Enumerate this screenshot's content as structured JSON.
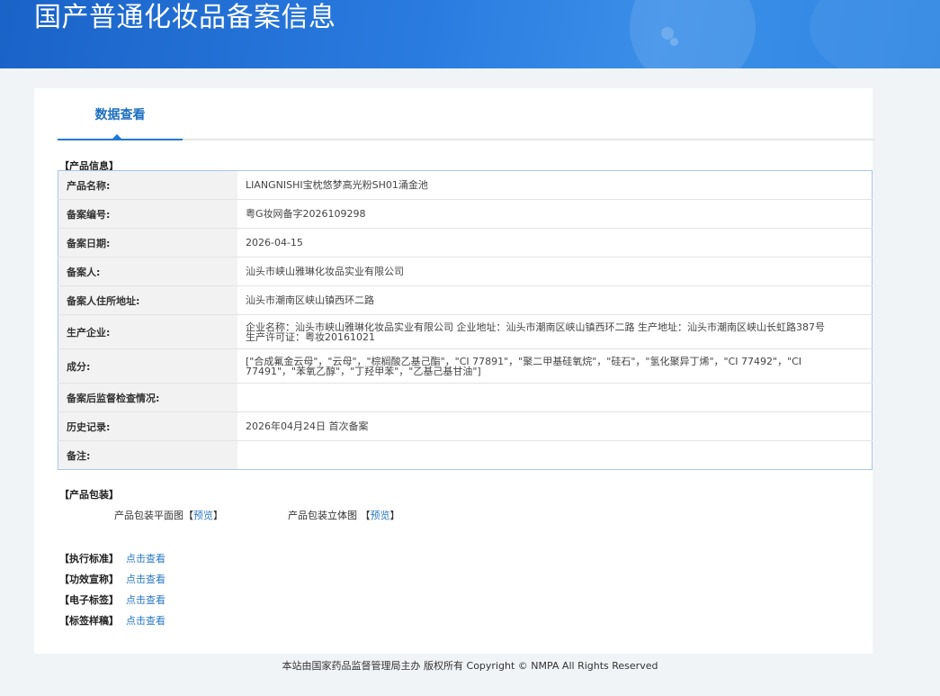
{
  "header": {
    "title": "国产普通化妆品备案信息"
  },
  "tabs": [
    {
      "label": "数据查看"
    }
  ],
  "product_info": {
    "section_title": "【产品信息】",
    "rows": [
      {
        "label": "产品名称:",
        "value": "LIANGNISHI宝枕悠梦高光粉SH01涌金池"
      },
      {
        "label": "备案编号:",
        "value": "粤G妆网备字2026109298"
      },
      {
        "label": "备案日期:",
        "value": "2026-04-15"
      },
      {
        "label": "备案人:",
        "value": "汕头市峡山雅琳化妆品实业有限公司"
      },
      {
        "label": "备案人住所地址:",
        "value": "汕头市潮南区峡山镇西环二路"
      },
      {
        "label": "生产企业:",
        "value": "企业名称：汕头市峡山雅琳化妆品实业有限公司 企业地址：汕头市潮南区峡山镇西环二路 生产地址：汕头市潮南区峡山长虹路387号 生产许可证：粤妆20161021"
      },
      {
        "label": "成分:",
        "value": "[\"合成氟金云母\"，\"云母\"，\"棕榈酸乙基己酯\"，\"CI 77891\"，\"聚二甲基硅氧烷\"，\"硅石\"，\"氢化聚异丁烯\"，\"CI 77492\"，\"CI 77491\"，\"苯氧乙醇\"，\"丁羟甲苯\"，\"乙基己基甘油\"]"
      },
      {
        "label": "备案后监督检查情况:",
        "value": ""
      },
      {
        "label": "历史记录:",
        "value": "2026年04月24日 首次备案"
      },
      {
        "label": "备注:",
        "value": ""
      }
    ]
  },
  "packaging": {
    "section_title": "【产品包装】",
    "flat_label": "产品包装平面图",
    "solid_label": "产品包装立体图",
    "open_bracket": "【",
    "close_bracket": "】",
    "preview_label": "预览"
  },
  "standards": [
    {
      "label": "【执行标准】",
      "link": "点击查看"
    },
    {
      "label": "【功效宣称】",
      "link": "点击查看"
    },
    {
      "label": "【电子标签】",
      "link": "点击查看"
    },
    {
      "label": "【标签样稿】",
      "link": "点击查看"
    }
  ],
  "footer": {
    "text": "本站由国家药品监督管理局主办 版权所有 Copyright © NMPA All Rights Reserved"
  },
  "colors": {
    "banner": "#2a7be0",
    "accent": "#1d7bd6",
    "link": "#2a78c6",
    "table_border": "#aac6e6"
  }
}
